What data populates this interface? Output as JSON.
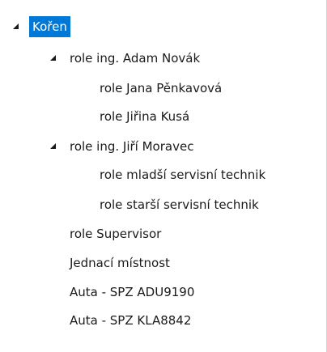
{
  "tree": {
    "root": {
      "label": "Kořen",
      "selected": true,
      "expanded": true
    },
    "children": [
      {
        "label": "role ing. Adam Novák",
        "expanded": true,
        "children": [
          {
            "label": "role Jana Pěnkavová"
          },
          {
            "label": "role Jiřina Kusá"
          }
        ]
      },
      {
        "label": "role ing. Jiří Moravec",
        "expanded": true,
        "children": [
          {
            "label": "role mladší servisní technik"
          },
          {
            "label": "role starší servisní technik"
          }
        ]
      },
      {
        "label": "role Supervisor"
      },
      {
        "label": "Jednací místnost"
      },
      {
        "label": "Auta - SPZ ADU9190"
      },
      {
        "label": "Auta - SPZ KLA8842"
      }
    ]
  },
  "colors": {
    "selection": "#0078d7",
    "expander": "#1a1a1a"
  },
  "icons": {
    "expanded": "expanded-triangle-icon"
  }
}
